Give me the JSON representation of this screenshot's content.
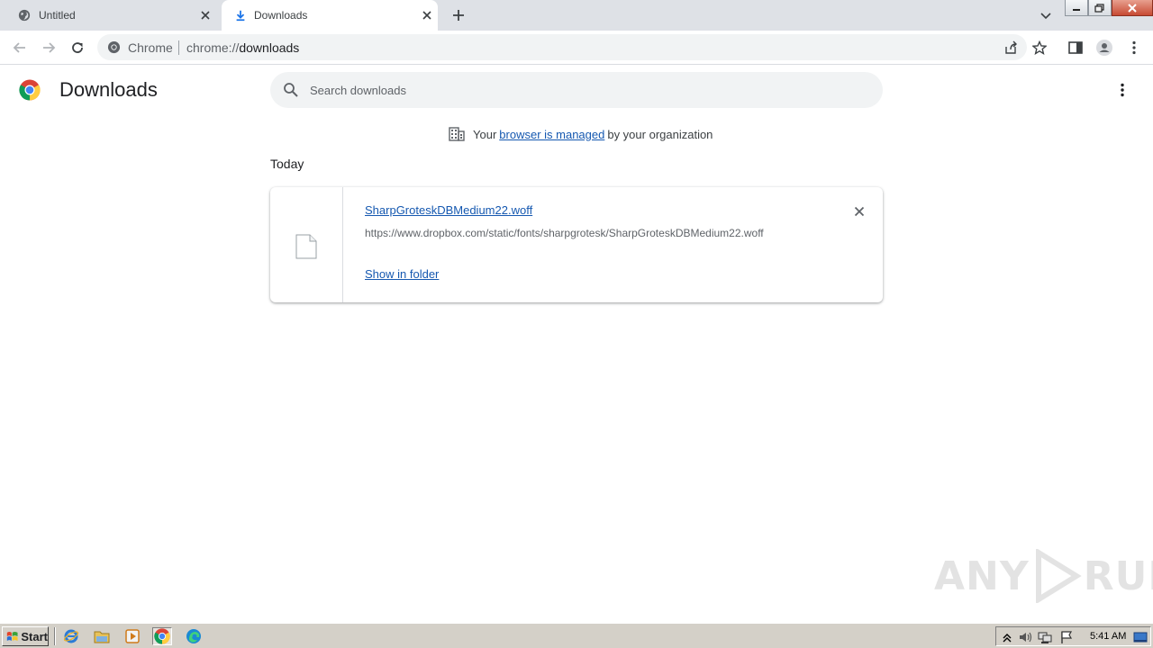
{
  "tabs": [
    {
      "title": "Untitled",
      "active": false
    },
    {
      "title": "Downloads",
      "active": true
    }
  ],
  "omnibox": {
    "chip_label": "Chrome",
    "url_scheme": "chrome://",
    "url_host": "downloads"
  },
  "page": {
    "title": "Downloads",
    "search_placeholder": "Search downloads",
    "managed_prefix": "Your",
    "managed_link": "browser is managed",
    "managed_suffix": "by your organization",
    "section_label": "Today"
  },
  "downloads": [
    {
      "file_name": "SharpGroteskDBMedium22.woff",
      "url": "https://www.dropbox.com/static/fonts/sharpgrotesk/SharpGroteskDBMedium22.woff",
      "action_label": "Show in folder"
    }
  ],
  "taskbar": {
    "start_label": "Start",
    "clock": "5:41 AM"
  },
  "watermark": {
    "left_text": "ANY",
    "right_text": "RUN"
  },
  "colors": {
    "link": "#1558b0",
    "tabstrip": "#dee1e6",
    "omnibox_bg": "#f1f3f4",
    "accent_blue": "#1a73e8"
  }
}
